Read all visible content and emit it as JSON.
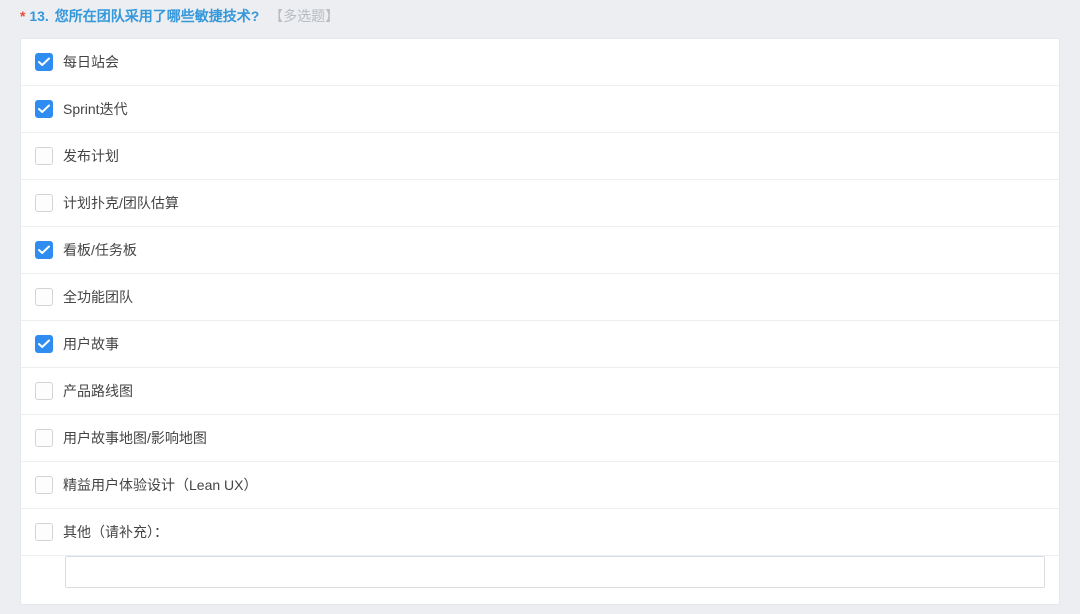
{
  "question": {
    "required_mark": "*",
    "number": "13.",
    "text": "您所在团队采用了哪些敏捷技术?",
    "type_label": "【多选题】"
  },
  "options": [
    {
      "label": "每日站会",
      "checked": true
    },
    {
      "label": "Sprint迭代",
      "checked": true
    },
    {
      "label": "发布计划",
      "checked": false
    },
    {
      "label": "计划扑克/团队估算",
      "checked": false
    },
    {
      "label": "看板/任务板",
      "checked": true
    },
    {
      "label": "全功能团队",
      "checked": false
    },
    {
      "label": "用户故事",
      "checked": true
    },
    {
      "label": "产品路线图",
      "checked": false
    },
    {
      "label": "用户故事地图/影响地图",
      "checked": false
    },
    {
      "label": "精益用户体验设计（Lean UX）",
      "checked": false
    },
    {
      "label": "其他（请补充）：",
      "checked": false,
      "has_input": true
    }
  ],
  "other_input": {
    "value": "",
    "placeholder": ""
  }
}
